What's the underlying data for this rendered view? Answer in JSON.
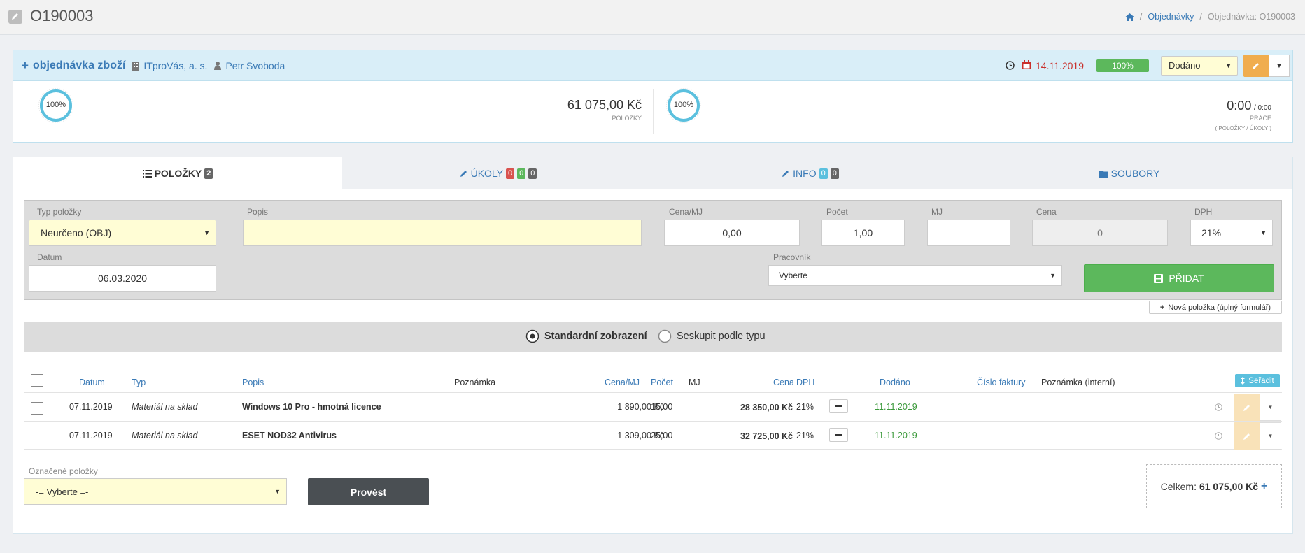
{
  "page": {
    "title": "O190003"
  },
  "breadcrumb": {
    "home": "",
    "orders": "Objednávky",
    "current": "Objednávka: O190003"
  },
  "order": {
    "type_label": "objednávka zboží",
    "company": "ITproVás, a. s.",
    "person": "Petr Svoboda",
    "date": "14.11.2019",
    "progress": "100%",
    "status": "Dodáno",
    "items_progress": "100%",
    "items_total": "61 075,00 Kč",
    "items_label": "POLOŽKY",
    "work_progress": "100%",
    "work_time": "0:00",
    "work_time_total": "/ 0:00",
    "work_label": "PRÁCE",
    "work_sub": "( POLOŽKY / ÚKOLY )"
  },
  "tabs": [
    {
      "label": "POLOŽKY",
      "badges": [
        "2"
      ]
    },
    {
      "label": "ÚKOLY",
      "badges": [
        "0",
        "0",
        "0"
      ]
    },
    {
      "label": "INFO",
      "badges": [
        "0",
        "0"
      ]
    },
    {
      "label": "SOUBORY",
      "badges": []
    }
  ],
  "form": {
    "type_label": "Typ položky",
    "type_value": "Neurčeno (OBJ)",
    "desc_label": "Popis",
    "desc_value": "",
    "unit_price_label": "Cena/MJ",
    "unit_price_value": "0,00",
    "count_label": "Počet",
    "count_value": "1,00",
    "unit_label": "MJ",
    "unit_value": "",
    "price_label": "Cena",
    "price_value": "0",
    "vat_label": "DPH",
    "vat_value": "21%",
    "date_label": "Datum",
    "date_value": "06.03.2020",
    "worker_label": "Pracovník",
    "worker_value": "Vyberte",
    "add_button": "PŘIDAT",
    "full_form_link": "Nová položka (úplný formulář)"
  },
  "view": {
    "standard": "Standardní zobrazení",
    "grouped": "Seskupit podle typu"
  },
  "table": {
    "headers": {
      "date": "Datum",
      "type": "Typ",
      "desc": "Popis",
      "note": "Poznámka",
      "unit_price": "Cena/MJ",
      "count": "Počet",
      "unit": "MJ",
      "price": "Cena",
      "vat": "DPH",
      "delivered": "Dodáno",
      "invoice": "Číslo faktury",
      "internal_note": "Poznámka (interní)",
      "sort": "Seřadit"
    },
    "rows": [
      {
        "date": "07.11.2019",
        "type": "Materiál na sklad",
        "desc": "Windows 10 Pro - hmotná licence",
        "unit_price": "1 890,00 Kč",
        "count": "15,00",
        "price": "28 350,00 Kč",
        "vat": "21%",
        "delivered": "11.11.2019"
      },
      {
        "date": "07.11.2019",
        "type": "Materiál na sklad",
        "desc": "ESET NOD32 Antivirus",
        "unit_price": "1 309,00 Kč",
        "count": "25,00",
        "price": "32 725,00 Kč",
        "vat": "21%",
        "delivered": "11.11.2019"
      }
    ]
  },
  "bulk": {
    "label": "Označené položky",
    "select": "-= Vyberte =-",
    "button": "Provést"
  },
  "total": {
    "label": "Celkem:",
    "value": "61 075,00 Kč"
  },
  "colors": {
    "accent": "#3a7ab6",
    "success": "#5cb85c",
    "danger": "#d9534f",
    "warning": "#f0ad4e",
    "info": "#5bc0de"
  }
}
